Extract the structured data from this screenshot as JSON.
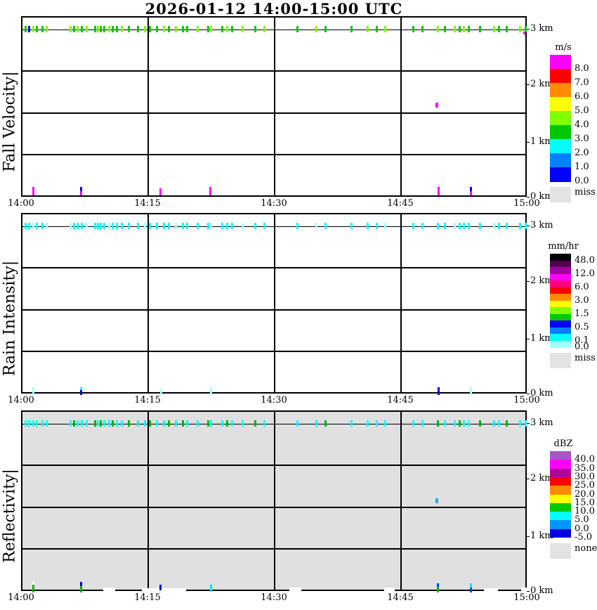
{
  "title": "2026-01-12  14:00-15:00 UTC",
  "chart_data": {
    "type": "heatmap",
    "subtype": "time-height profile (3 stacked panels)",
    "date": "2026-01-12",
    "time_range": [
      "14:00",
      "15:00"
    ],
    "x_ticks": [
      "14:00",
      "14:15",
      "14:30",
      "14:45",
      "15:00"
    ],
    "y_ticks": [
      "3 km",
      "2 km",
      "1 km",
      "0 km"
    ],
    "y_range_km": [
      0,
      3.2
    ],
    "grid": "on",
    "mark_colors": {
      "g": "#00C800",
      "l": "#7FFF00",
      "b": "#0000FF",
      "m": "#FF00FF",
      "c": "#00FFFF",
      "p": "#A8FFFF",
      "G": "#00B400",
      "d": "#0000E0",
      "w": "#FFFFFF",
      "s": "#29A8E0",
      "y": "#00E5FF",
      "n": "#0000C0",
      "r": "#0040FF"
    },
    "top_row_xs": [
      3,
      8,
      14,
      19,
      27,
      33,
      67,
      72,
      77,
      83,
      90,
      102,
      106,
      110,
      115,
      122,
      127,
      133,
      140,
      150,
      163,
      173,
      180,
      190,
      200,
      207,
      217,
      227,
      233,
      248,
      263,
      267,
      283,
      290,
      297,
      312,
      330,
      343,
      390,
      417,
      430,
      467,
      490,
      503,
      515,
      555,
      568,
      590,
      600,
      614,
      621,
      627,
      634,
      650,
      670,
      677,
      688,
      707,
      715
    ],
    "panels": [
      {
        "name": "fall-velocity",
        "label": "Fall Velocity|",
        "bg": "#FFFFFF",
        "top_row_colors": [
          "g",
          "b",
          "l",
          "g",
          "g",
          "l",
          "l",
          "g",
          "l",
          "g",
          "l",
          "g",
          "l",
          "g",
          "g",
          "l",
          "g",
          "g",
          "l",
          "g",
          "g",
          "l",
          "g",
          "g",
          "l",
          "g",
          "l",
          "g",
          "g",
          "l",
          "g",
          "l",
          "g",
          "l",
          "g",
          "l",
          "g",
          "l",
          "g",
          "l",
          "g",
          "g",
          "l",
          "g",
          "l",
          "g",
          "g",
          "l",
          "g",
          "l",
          "g",
          "l",
          "g",
          "g",
          "l",
          "g",
          "g",
          "l",
          "g"
        ],
        "marks_mid": [
          {
            "x": 588,
            "y": 121,
            "w": 4,
            "h": 7,
            "c": "m"
          },
          {
            "x": 713,
            "y": 20,
            "w": 3,
            "h": 4,
            "c": "m"
          }
        ],
        "marks_bottom": [
          {
            "x": 14,
            "y": 241,
            "h": 12,
            "c": "m"
          },
          {
            "x": 82,
            "y": 241,
            "h": 6,
            "c": "b"
          },
          {
            "x": 82,
            "y": 247,
            "h": 6,
            "c": "m"
          },
          {
            "x": 195,
            "y": 243,
            "h": 10,
            "c": "m"
          },
          {
            "x": 266,
            "y": 241,
            "h": 12,
            "c": "m"
          },
          {
            "x": 591,
            "y": 241,
            "h": 12,
            "c": "m"
          },
          {
            "x": 637,
            "y": 241,
            "h": 6,
            "c": "b"
          },
          {
            "x": 637,
            "y": 247,
            "h": 6,
            "c": "m"
          }
        ],
        "patches": [],
        "colorbar": {
          "title": "m/s",
          "seg_h": 20,
          "top_rel": 55,
          "segments": [
            {
              "color": "#FF00FF",
              "label": "8.0"
            },
            {
              "color": "#FF0000",
              "label": "7.0"
            },
            {
              "color": "#FF8C00",
              "label": "6.0"
            },
            {
              "color": "#FFFF00",
              "label": "5.0"
            },
            {
              "color": "#7FFF00",
              "label": "4.0"
            },
            {
              "color": "#00C800",
              "label": "3.0"
            },
            {
              "color": "#00FFFF",
              "label": "2.0"
            },
            {
              "color": "#0080FF",
              "label": "1.0"
            },
            {
              "color": "#0000FF",
              "label": "0.0"
            }
          ],
          "footer_label": "miss",
          "footer_color": "#E3E3E3"
        }
      },
      {
        "name": "rain-intensity",
        "label": "Rain Intensity|",
        "bg": "#FFFFFF",
        "top_row_colors": [
          "c",
          "c",
          "p",
          "c",
          "c",
          "p",
          "p",
          "c",
          "c",
          "c",
          "p",
          "c",
          "c",
          "c",
          "c",
          "p",
          "c",
          "c",
          "c",
          "c",
          "c",
          "p",
          "c",
          "c",
          "c",
          "c",
          "p",
          "c",
          "c",
          "c",
          "c",
          "p",
          "c",
          "c",
          "c",
          "p",
          "c",
          "c",
          "c",
          "p",
          "c",
          "c",
          "c",
          "c",
          "p",
          "c",
          "c",
          "c",
          "c",
          "p",
          "c",
          "c",
          "c",
          "c",
          "p",
          "c",
          "c",
          "c",
          "c"
        ],
        "marks_mid": [],
        "marks_bottom": [
          {
            "x": 14,
            "y": 246,
            "h": 11,
            "c": "p"
          },
          {
            "x": 82,
            "y": 246,
            "h": 4,
            "c": "c"
          },
          {
            "x": 82,
            "y": 250,
            "h": 7,
            "c": "d"
          },
          {
            "x": 196,
            "y": 248,
            "h": 9,
            "c": "p"
          },
          {
            "x": 267,
            "y": 246,
            "h": 11,
            "c": "p"
          },
          {
            "x": 591,
            "y": 246,
            "h": 11,
            "c": "d"
          },
          {
            "x": 637,
            "y": 246,
            "h": 11,
            "c": "p"
          }
        ],
        "patches": [],
        "colorbar": {
          "title": "mm/hr",
          "seg_h": 9.5,
          "top_rel": 58,
          "segments": [
            {
              "color": "#000000",
              "label": "48.0"
            },
            {
              "color": "#500050",
              "label": ""
            },
            {
              "color": "#A000A0",
              "label": "12.0"
            },
            {
              "color": "#FF00FF",
              "label": ""
            },
            {
              "color": "#FF0080",
              "label": "6.0"
            },
            {
              "color": "#FF0000",
              "label": ""
            },
            {
              "color": "#FF8C00",
              "label": "3.0"
            },
            {
              "color": "#FFFF00",
              "label": ""
            },
            {
              "color": "#7FFF00",
              "label": "1.5"
            },
            {
              "color": "#00C800",
              "label": ""
            },
            {
              "color": "#0000FF",
              "label": "0.5"
            },
            {
              "color": "#0080FF",
              "label": ""
            },
            {
              "color": "#00FFFF",
              "label": "0.1"
            },
            {
              "color": "#A8FFFF",
              "label": "0.0"
            }
          ],
          "footer_label": "miss",
          "footer_color": "#E3E3E3"
        }
      },
      {
        "name": "reflectivity",
        "label": "Reflectivity|",
        "bg": "#E0E0E0",
        "top_row_colors": [
          "c",
          "c",
          "c",
          "c",
          "c",
          "c",
          "c",
          "G",
          "c",
          "c",
          "c",
          "G",
          "c",
          "G",
          "c",
          "c",
          "G",
          "c",
          "c",
          "G",
          "c",
          "c",
          "G",
          "c",
          "c",
          "G",
          "c",
          "G",
          "c",
          "c",
          "G",
          "c",
          "c",
          "G",
          "c",
          "c",
          "G",
          "c",
          "c",
          "c",
          "G",
          "c",
          "c",
          "c",
          "c",
          "c",
          "c",
          "G",
          "c",
          "c",
          "G",
          "c",
          "c",
          "G",
          "c",
          "c",
          "G",
          "c",
          "c"
        ],
        "marks_mid": [
          {
            "x": 588,
            "y": 123,
            "w": 4,
            "h": 7,
            "c": "s"
          }
        ],
        "marks_bottom": [
          {
            "x": 14,
            "y": 242,
            "h": 4,
            "c": "w"
          },
          {
            "x": 14,
            "y": 246,
            "h": 11,
            "c": "G"
          },
          {
            "x": 82,
            "y": 242,
            "h": 6,
            "c": "d"
          },
          {
            "x": 82,
            "y": 248,
            "h": 9,
            "c": "G"
          },
          {
            "x": 195,
            "y": 246,
            "h": 8,
            "c": "n"
          },
          {
            "x": 267,
            "y": 246,
            "h": 10,
            "c": "y"
          },
          {
            "x": 590,
            "y": 244,
            "h": 5,
            "c": "r"
          },
          {
            "x": 590,
            "y": 249,
            "h": 8,
            "c": "G"
          },
          {
            "x": 637,
            "y": 244,
            "h": 6,
            "c": "y"
          },
          {
            "x": 637,
            "y": 250,
            "h": 7,
            "c": "r"
          }
        ],
        "patches": [
          {
            "x": 115,
            "w": 17,
            "y": 250,
            "h": 5
          },
          {
            "x": 170,
            "w": 63,
            "y": 251,
            "h": 6
          },
          {
            "x": 380,
            "w": 17,
            "y": 250,
            "h": 5
          },
          {
            "x": 515,
            "w": 15,
            "y": 250,
            "h": 6
          },
          {
            "x": 657,
            "w": 20,
            "y": 251,
            "h": 5
          },
          {
            "x": 710,
            "w": 8,
            "y": 250,
            "h": 5
          }
        ],
        "colorbar": {
          "title": "dBZ",
          "seg_h": 12.3,
          "top_rel": 58,
          "segments": [
            {
              "color": "#A855C8",
              "label": "40.0"
            },
            {
              "color": "#FF00FF",
              "label": "35.0"
            },
            {
              "color": "#B4009B",
              "label": "30.0"
            },
            {
              "color": "#FF0000",
              "label": "25.0"
            },
            {
              "color": "#FF8C00",
              "label": "20.0"
            },
            {
              "color": "#FFFF00",
              "label": "15.0"
            },
            {
              "color": "#00C800",
              "label": "10.0"
            },
            {
              "color": "#00FFFF",
              "label": "5.0"
            },
            {
              "color": "#0096FF",
              "label": "0.0"
            },
            {
              "color": "#0000DC",
              "label": "-5.0"
            }
          ],
          "footer_label": "none",
          "footer_color": "#E3E3E3"
        }
      }
    ]
  }
}
